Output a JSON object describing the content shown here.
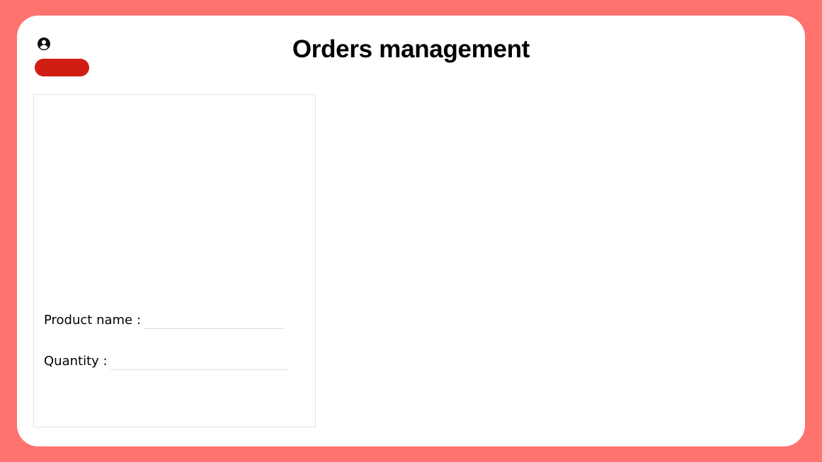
{
  "header": {
    "title": "Orders management",
    "user_icon": "user-circle-icon",
    "logout_button": {
      "label": "",
      "color": "#d11e15"
    }
  },
  "form": {
    "product_name": {
      "label": "Product name :",
      "value": ""
    },
    "quantity": {
      "label": "Quantity :",
      "value": ""
    }
  },
  "colors": {
    "background": "#fe7270",
    "card": "#ffffff",
    "accent": "#d11e15"
  }
}
